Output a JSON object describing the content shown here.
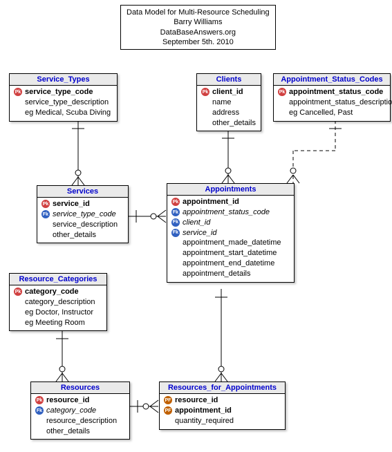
{
  "title": {
    "line1": "Data Model for Multi-Resource Scheduling",
    "line2": "Barry Williams",
    "line3": "DataBaseAnswers.org",
    "line4": "September 5th. 2010"
  },
  "entities": {
    "service_types": {
      "name": "Service_Types",
      "attrs": [
        {
          "key": "PK",
          "keytext": "Pk",
          "name": "service_type_code",
          "style": "bold"
        },
        {
          "key": "",
          "keytext": "",
          "name": "service_type_description",
          "style": ""
        },
        {
          "key": "",
          "keytext": "",
          "name": "eg Medical, Scuba Diving",
          "style": ""
        }
      ]
    },
    "clients": {
      "name": "Clients",
      "attrs": [
        {
          "key": "PK",
          "keytext": "Pk",
          "name": "client_id",
          "style": "bold"
        },
        {
          "key": "",
          "keytext": "",
          "name": "name",
          "style": ""
        },
        {
          "key": "",
          "keytext": "",
          "name": "address",
          "style": ""
        },
        {
          "key": "",
          "keytext": "",
          "name": "other_details",
          "style": ""
        }
      ]
    },
    "appt_status_codes": {
      "name": "Appointment_Status_Codes",
      "attrs": [
        {
          "key": "PK",
          "keytext": "Pk",
          "name": "appointment_status_code",
          "style": "bold"
        },
        {
          "key": "",
          "keytext": "",
          "name": "appointment_status_description",
          "style": ""
        },
        {
          "key": "",
          "keytext": "",
          "name": "eg Cancelled, Past",
          "style": ""
        }
      ]
    },
    "services": {
      "name": "Services",
      "attrs": [
        {
          "key": "PK",
          "keytext": "Pk",
          "name": "service_id",
          "style": "bold"
        },
        {
          "key": "FK",
          "keytext": "Fk",
          "name": "service_type_code",
          "style": "italic"
        },
        {
          "key": "",
          "keytext": "",
          "name": "service_description",
          "style": ""
        },
        {
          "key": "",
          "keytext": "",
          "name": "other_details",
          "style": ""
        }
      ]
    },
    "appointments": {
      "name": "Appointments",
      "attrs": [
        {
          "key": "PK",
          "keytext": "Pk",
          "name": "appointment_id",
          "style": "bold"
        },
        {
          "key": "FK",
          "keytext": "Fk",
          "name": "appointment_status_code",
          "style": "italic"
        },
        {
          "key": "FK",
          "keytext": "Fk",
          "name": "client_id",
          "style": "italic"
        },
        {
          "key": "FK",
          "keytext": "Fk",
          "name": "service_id",
          "style": "italic"
        },
        {
          "key": "",
          "keytext": "",
          "name": "appointment_made_datetime",
          "style": ""
        },
        {
          "key": "",
          "keytext": "",
          "name": "appointment_start_datetime",
          "style": ""
        },
        {
          "key": "",
          "keytext": "",
          "name": "appointment_end_datetime",
          "style": ""
        },
        {
          "key": "",
          "keytext": "",
          "name": "appointment_details",
          "style": ""
        }
      ]
    },
    "resource_categories": {
      "name": "Resource_Categories",
      "attrs": [
        {
          "key": "PK",
          "keytext": "Pk",
          "name": "category_code",
          "style": "bold"
        },
        {
          "key": "",
          "keytext": "",
          "name": "category_description",
          "style": ""
        },
        {
          "key": "",
          "keytext": "",
          "name": "eg Doctor, Instructor",
          "style": ""
        },
        {
          "key": "",
          "keytext": "",
          "name": "eg Meeting Room",
          "style": ""
        }
      ]
    },
    "resources": {
      "name": "Resources",
      "attrs": [
        {
          "key": "PK",
          "keytext": "Pk",
          "name": "resource_id",
          "style": "bold"
        },
        {
          "key": "FK",
          "keytext": "Fk",
          "name": "category_code",
          "style": "italic"
        },
        {
          "key": "",
          "keytext": "",
          "name": "resource_description",
          "style": ""
        },
        {
          "key": "",
          "keytext": "",
          "name": "other_details",
          "style": ""
        }
      ]
    },
    "resources_for_appointments": {
      "name": "Resources_for_Appointments",
      "attrs": [
        {
          "key": "PF",
          "keytext": "PF",
          "name": "resource_id",
          "style": "bold"
        },
        {
          "key": "PF",
          "keytext": "PF",
          "name": "appointment_id",
          "style": "bold"
        },
        {
          "key": "",
          "keytext": "",
          "name": "quantity_required",
          "style": ""
        }
      ]
    }
  }
}
